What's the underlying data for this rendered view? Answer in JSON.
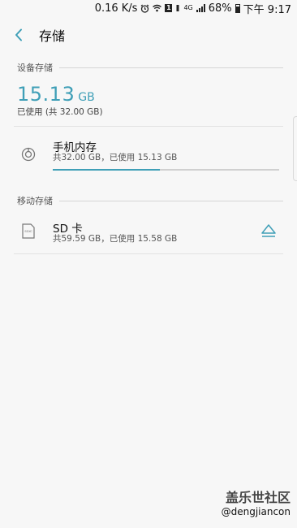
{
  "status_bar": {
    "net_speed": "0.16 K/s",
    "sim_badge": "1",
    "network_type": "4G",
    "battery_percent": "68%",
    "time": "下午 9:17"
  },
  "header": {
    "title": "存储"
  },
  "device_storage": {
    "section_title": "设备存储",
    "used_value": "15.13",
    "used_unit": "GB",
    "used_fraction": 0.473,
    "summary": "已使用 (共 32.00 GB)"
  },
  "phone_memory": {
    "title": "手机内存",
    "detail": "共32.00 GB，已使用 15.13 GB",
    "used_fraction": 0.473
  },
  "removable_storage": {
    "section_title": "移动存储"
  },
  "sd_card": {
    "title": "SD 卡",
    "detail": "共59.59 GB，已使用 15.58 GB",
    "icon_text": "SDXC"
  },
  "watermark": {
    "site": "盖乐世社区",
    "user": "@dengjiancon"
  },
  "colors": {
    "accent": "#3f9fb7",
    "background": "#f7f7f7"
  }
}
